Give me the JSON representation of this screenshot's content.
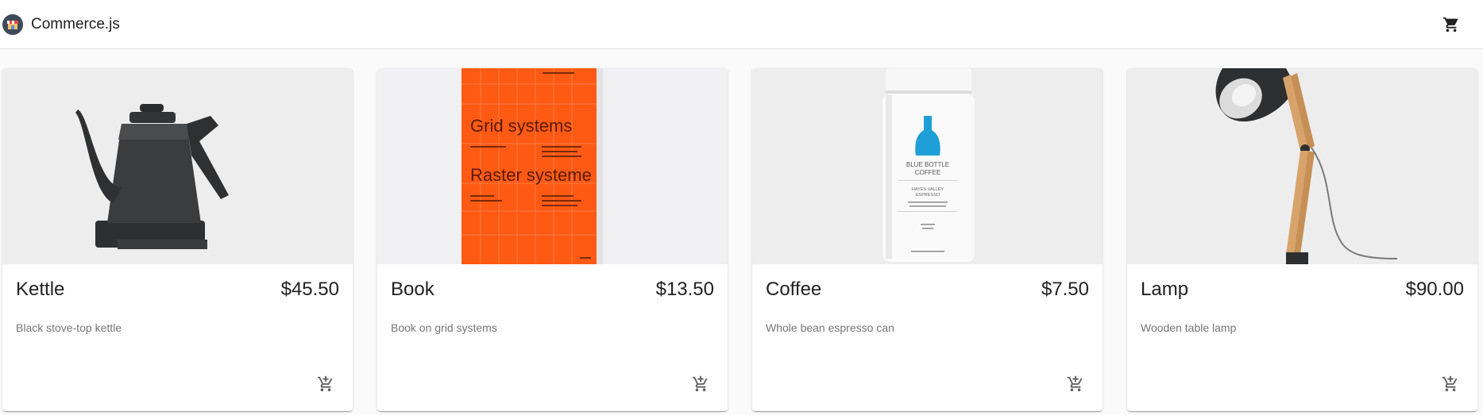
{
  "header": {
    "title": "Commerce.js",
    "logo_icon": "store-icon",
    "cart_icon": "shopping-cart-icon"
  },
  "products": [
    {
      "name": "Kettle",
      "price": "$45.50",
      "description": "Black stove-top kettle",
      "add_icon": "add-to-cart-icon"
    },
    {
      "name": "Book",
      "price": "$13.50",
      "description": "Book on grid systems",
      "add_icon": "add-to-cart-icon",
      "cover_text": {
        "title_1": "Grid systems",
        "title_2": "Raster systeme"
      }
    },
    {
      "name": "Coffee",
      "price": "$7.50",
      "description": "Whole bean espresso can",
      "add_icon": "add-to-cart-icon",
      "can_text": {
        "brand_1": "BLUE BOTTLE",
        "brand_2": "COFFEE",
        "variety_1": "HAYES VALLEY",
        "variety_2": "ESPRESSO"
      }
    },
    {
      "name": "Lamp",
      "price": "$90.00",
      "description": "Wooden table lamp",
      "add_icon": "add-to-cart-icon"
    }
  ],
  "colors": {
    "background": "#fafafa",
    "card": "#ffffff",
    "text_primary": "#212121",
    "text_secondary": "#757575",
    "book_orange": "#ff5a14"
  }
}
